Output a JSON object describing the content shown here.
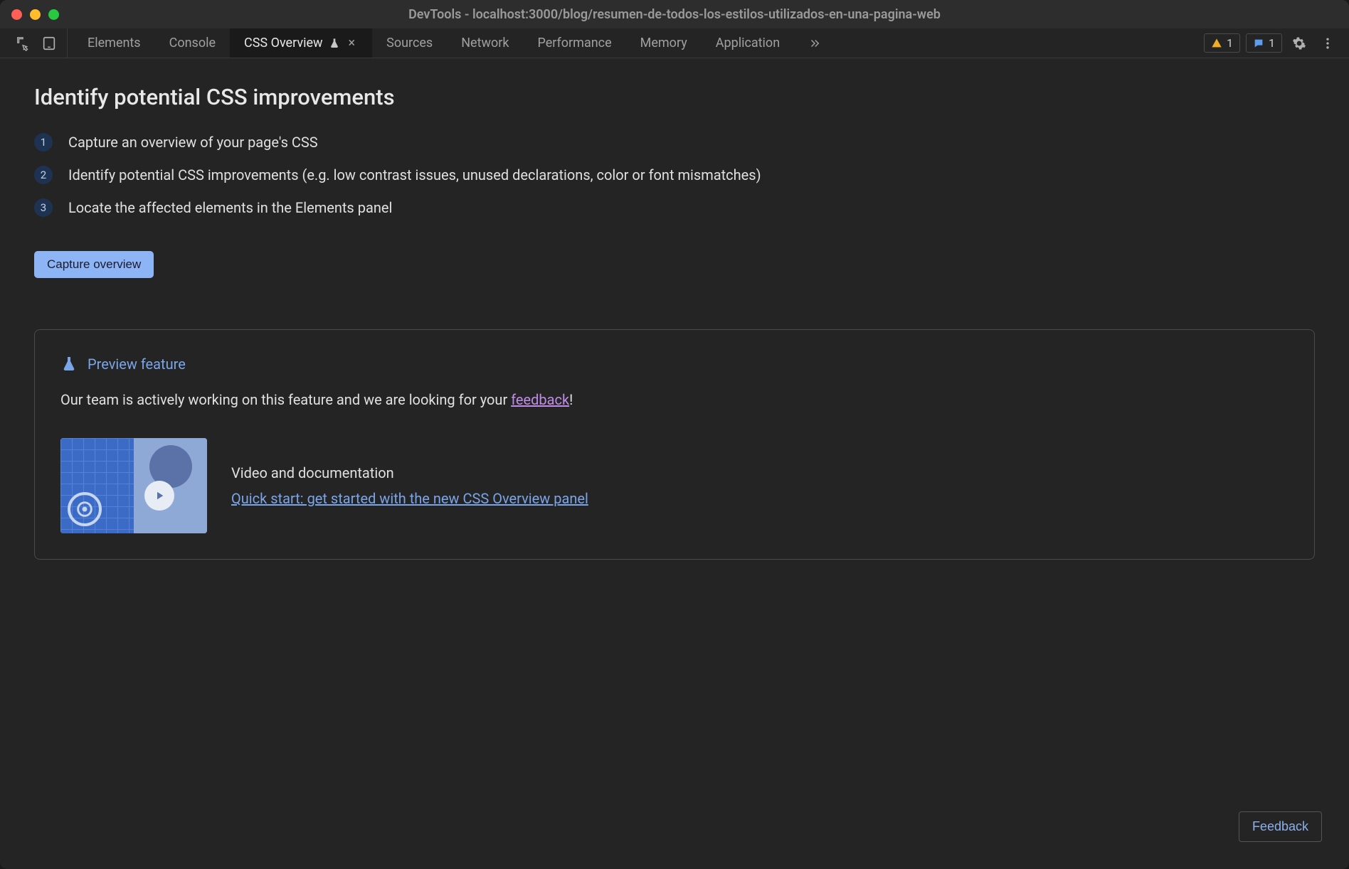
{
  "titlebar": {
    "title": "DevTools - localhost:3000/blog/resumen-de-todos-los-estilos-utilizados-en-una-pagina-web"
  },
  "tabs": {
    "items": [
      {
        "label": "Elements"
      },
      {
        "label": "Console"
      },
      {
        "label": "CSS Overview",
        "active": true,
        "experimental": true,
        "closeable": true
      },
      {
        "label": "Sources"
      },
      {
        "label": "Network"
      },
      {
        "label": "Performance"
      },
      {
        "label": "Memory"
      },
      {
        "label": "Application"
      }
    ],
    "warnings_count": "1",
    "messages_count": "1"
  },
  "panel": {
    "heading": "Identify potential CSS improvements",
    "steps": [
      {
        "num": "1",
        "text": "Capture an overview of your page's CSS"
      },
      {
        "num": "2",
        "text": "Identify potential CSS improvements (e.g. low contrast issues, unused declarations, color or font mismatches)"
      },
      {
        "num": "3",
        "text": "Locate the affected elements in the Elements panel"
      }
    ],
    "capture_button": "Capture overview",
    "preview": {
      "title": "Preview feature",
      "text_prefix": "Our team is actively working on this feature and we are looking for your ",
      "feedback_link": "feedback",
      "text_suffix": "!",
      "doc_label": "Video and documentation",
      "doc_link": "Quick start: get started with the new CSS Overview panel"
    },
    "feedback_button": "Feedback"
  }
}
